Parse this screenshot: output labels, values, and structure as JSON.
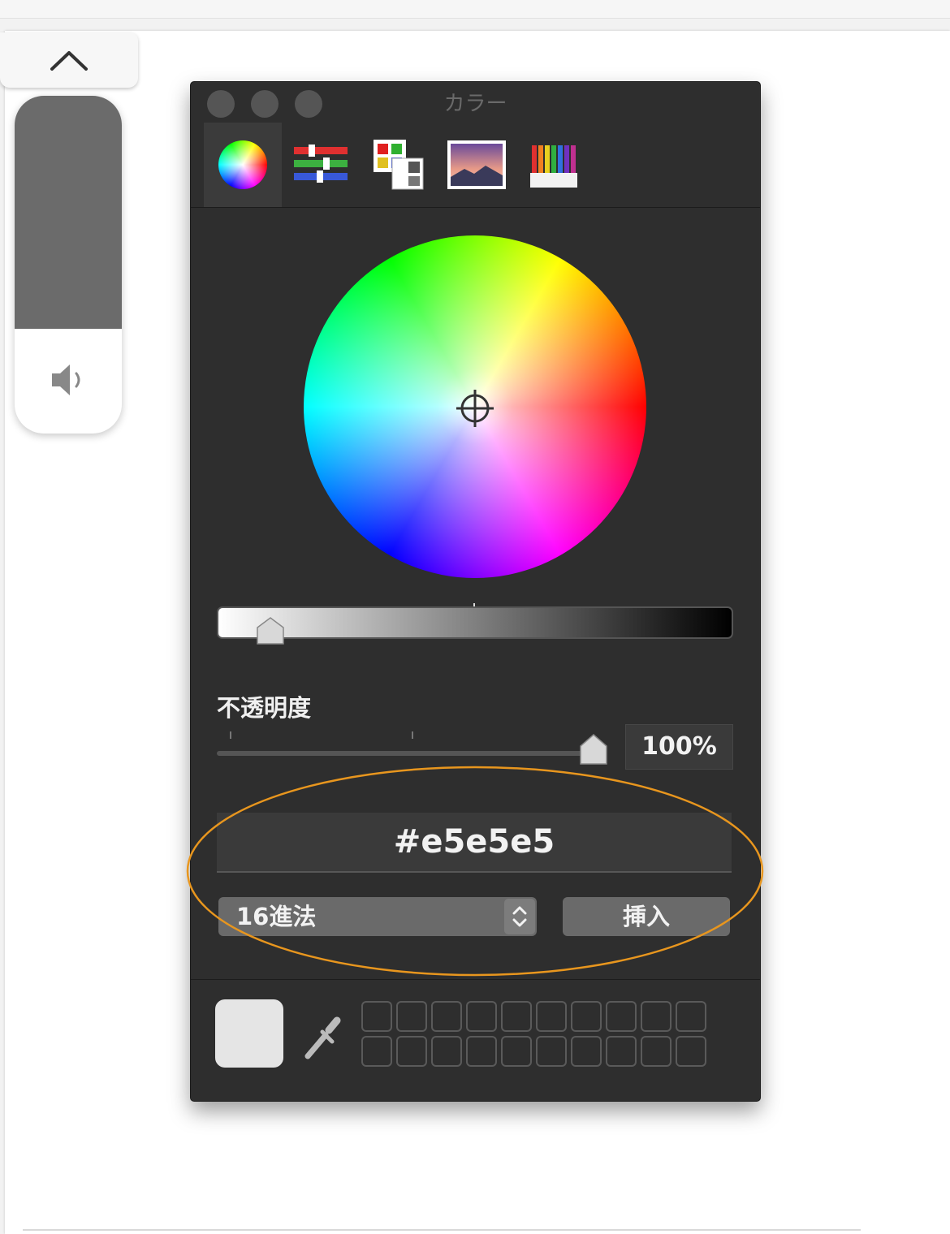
{
  "window": {
    "title": "カラー"
  },
  "toolbar": {
    "tabs": [
      {
        "icon": "color-wheel-icon",
        "active": true
      },
      {
        "icon": "color-sliders-icon",
        "active": false
      },
      {
        "icon": "color-palettes-icon",
        "active": false
      },
      {
        "icon": "image-palettes-icon",
        "active": false
      },
      {
        "icon": "pencils-icon",
        "active": false
      }
    ]
  },
  "volume": {
    "level": 0.69
  },
  "brightness": {
    "level": 0.1
  },
  "opacity": {
    "label": "不透明度",
    "value": "100%"
  },
  "hex": {
    "value": "#e5e5e5"
  },
  "format": {
    "selected": "16進法"
  },
  "insert_label": "挿入",
  "current_color": "#e5e5e5",
  "highlight_color": "#e8961e"
}
